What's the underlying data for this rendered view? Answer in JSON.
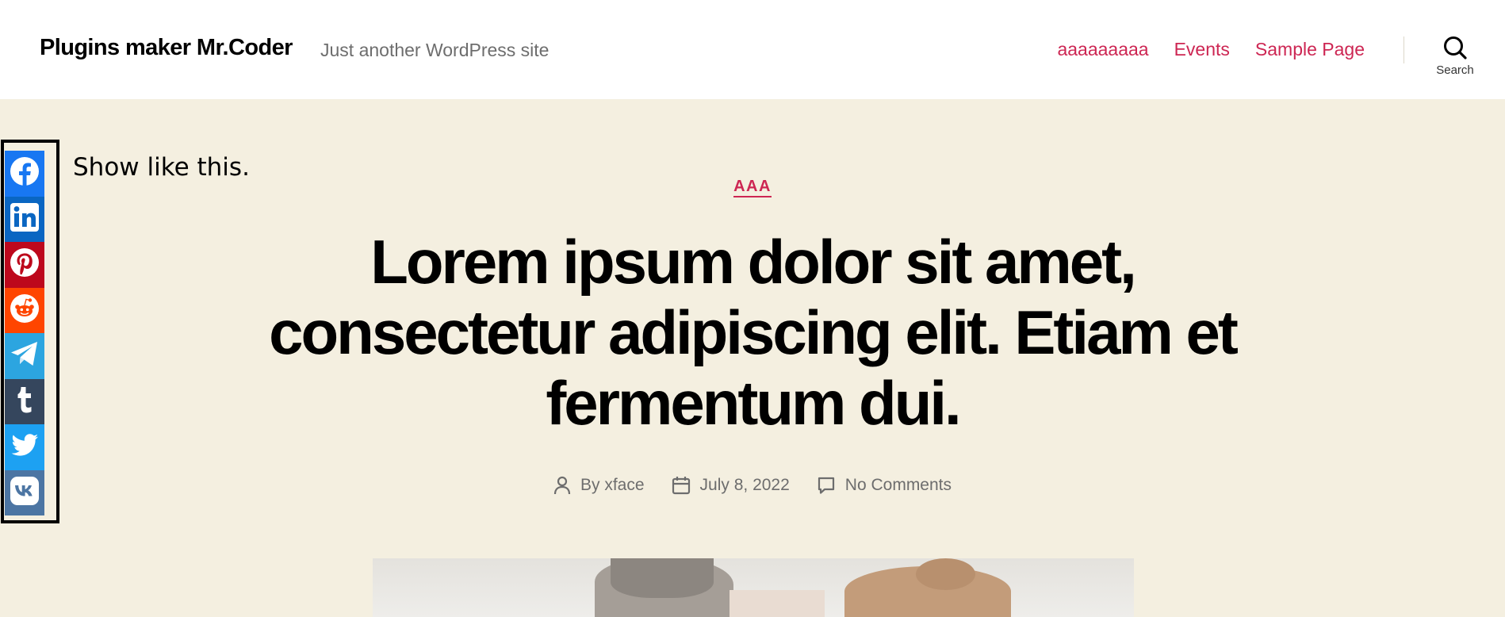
{
  "site": {
    "title": "Plugins maker Mr.Coder",
    "description": "Just another WordPress site"
  },
  "nav": {
    "items": [
      "aaaaaaaaa",
      "Events",
      "Sample Page"
    ],
    "search_label": "Search"
  },
  "share": {
    "note": "Show like this.",
    "buttons": [
      {
        "name": "facebook",
        "icon": "facebook-icon",
        "color": "#1877f2"
      },
      {
        "name": "linkedin",
        "icon": "linkedin-icon",
        "color": "#0a66c2"
      },
      {
        "name": "pinterest",
        "icon": "pinterest-icon",
        "color": "#bd081c"
      },
      {
        "name": "reddit",
        "icon": "reddit-icon",
        "color": "#ff4500"
      },
      {
        "name": "telegram",
        "icon": "telegram-icon",
        "color": "#2ca5e0"
      },
      {
        "name": "tumblr",
        "icon": "tumblr-icon",
        "color": "#35465d"
      },
      {
        "name": "twitter",
        "icon": "twitter-icon",
        "color": "#1da1f2"
      },
      {
        "name": "vk",
        "icon": "vk-icon",
        "color": "#4c75a3"
      }
    ]
  },
  "post": {
    "category": "AAA",
    "title": "Lorem ipsum dolor sit amet, consectetur adipiscing elit. Etiam et fermentum dui.",
    "author_prefix": "By",
    "author": "xface",
    "date": "July 8, 2022",
    "comments": "No Comments"
  },
  "colors": {
    "accent": "#cd2653",
    "background": "#f4efe0",
    "header_bg": "#ffffff"
  }
}
